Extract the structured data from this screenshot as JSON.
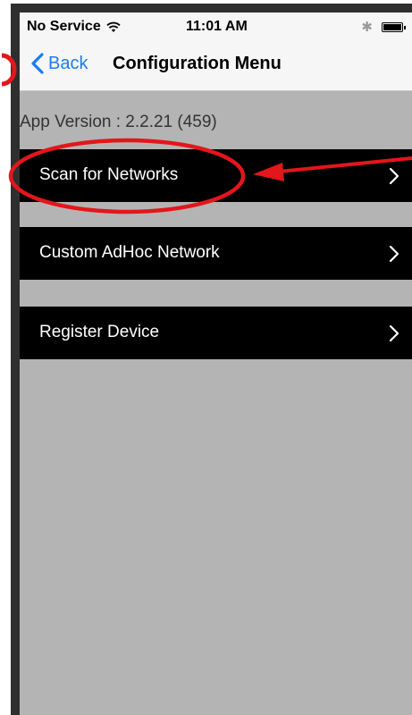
{
  "status_bar": {
    "carrier": "No Service",
    "wifi_icon": "wifi-icon",
    "time": "11:01 AM",
    "bluetooth_icon": "bluetooth-icon",
    "battery_icon": "battery-icon"
  },
  "nav": {
    "back_label": "Back",
    "title": "Configuration Menu"
  },
  "app_version": "App Version : 2.2.21 (459)",
  "menu": {
    "items": [
      {
        "label": "Scan for Networks"
      },
      {
        "label": "Custom AdHoc Network"
      },
      {
        "label": "Register Device"
      }
    ]
  },
  "colors": {
    "accent": "#1a7cf5",
    "annotation": "#e3161b",
    "background": "#b4b4b4",
    "row": "#000000"
  }
}
